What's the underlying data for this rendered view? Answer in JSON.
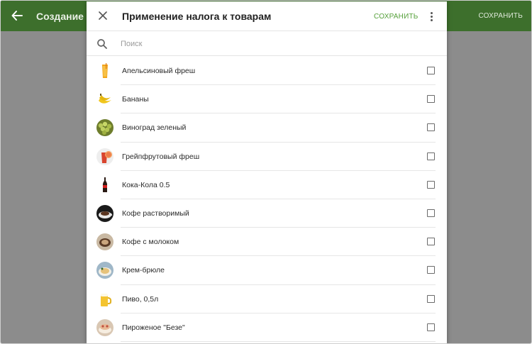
{
  "background": {
    "title": "Создание на",
    "save_label": "СОХРАНИТЬ",
    "back_icon": "arrow-left-icon"
  },
  "dialog": {
    "title": "Применение налога к товарам",
    "save_label": "СОХРАНИТЬ",
    "close_icon": "close-icon",
    "more_icon": "more-vert-icon",
    "search": {
      "placeholder": "Поиск",
      "value": "",
      "icon": "search-icon"
    },
    "items": [
      {
        "label": "Апельсиновый фреш",
        "checked": false,
        "image": "orange-juice"
      },
      {
        "label": "Бананы",
        "checked": false,
        "image": "bananas"
      },
      {
        "label": "Виноград зеленый",
        "checked": false,
        "image": "green-grapes"
      },
      {
        "label": "Грейпфрутовый фреш",
        "checked": false,
        "image": "grapefruit-juice"
      },
      {
        "label": "Кока-Кола 0.5",
        "checked": false,
        "image": "cola-bottle"
      },
      {
        "label": "Кофе растворимый",
        "checked": false,
        "image": "instant-coffee"
      },
      {
        "label": "Кофе с молоком",
        "checked": false,
        "image": "coffee-with-milk"
      },
      {
        "label": "Крем-брюле",
        "checked": false,
        "image": "creme-brulee"
      },
      {
        "label": "Пиво, 0,5л",
        "checked": false,
        "image": "beer-mug"
      },
      {
        "label": "Пироженое \"Безе\"",
        "checked": false,
        "image": "meringue-cake"
      }
    ]
  },
  "colors": {
    "appbar": "#3d6f2c",
    "accent": "#55a03a",
    "overlay": "#8c8c8c"
  }
}
